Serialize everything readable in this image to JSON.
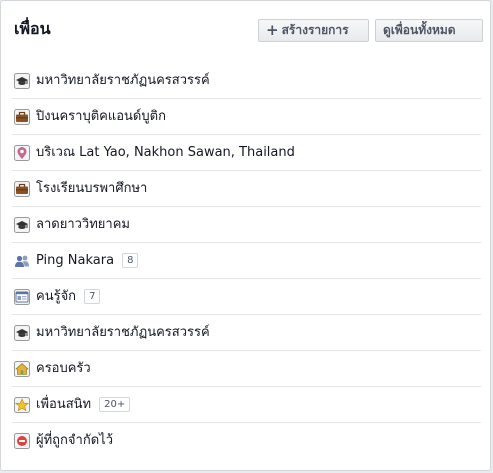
{
  "header": {
    "title": "เพื่อน",
    "create_button": {
      "icon": "plus-icon",
      "label": "สร้างรายการ"
    },
    "see_all_button": {
      "label": "ดูเพื่อนทั้งหมด"
    }
  },
  "lists": [
    {
      "icon": "graduation-cap-icon",
      "label": "มหาวิทยาลัยราชภัฏนครสวรรค์",
      "count": null
    },
    {
      "icon": "briefcase-icon",
      "label": "ปิงนคราบุติคแอนด์บูติก",
      "count": null
    },
    {
      "icon": "map-pin-icon",
      "label": "บริเวณ Lat Yao, Nakhon Sawan, Thailand",
      "count": null
    },
    {
      "icon": "briefcase-icon",
      "label": "โรงเรียนบรพาศึกษา",
      "count": null
    },
    {
      "icon": "graduation-cap-icon",
      "label": "ลาดยาววิทยาคม",
      "count": null
    },
    {
      "icon": "people-icon",
      "label": "Ping Nakara",
      "count": "8"
    },
    {
      "icon": "id-card-icon",
      "label": "คนรู้จัก",
      "count": "7"
    },
    {
      "icon": "graduation-cap-icon",
      "label": "มหาวิทยาลัยราชภัฏนครสวรรค์",
      "count": null
    },
    {
      "icon": "house-icon",
      "label": "ครอบครัว",
      "count": null
    },
    {
      "icon": "star-icon",
      "label": "เพื่อนสนิท",
      "count": "20+"
    },
    {
      "icon": "restricted-icon",
      "label": "ผู้ที่ถูกจำกัดไว้",
      "count": null
    }
  ],
  "colors": {
    "text": "#141823",
    "border": "#d3d6db",
    "button_text": "#4e5665",
    "divider": "#e5e5e5"
  }
}
